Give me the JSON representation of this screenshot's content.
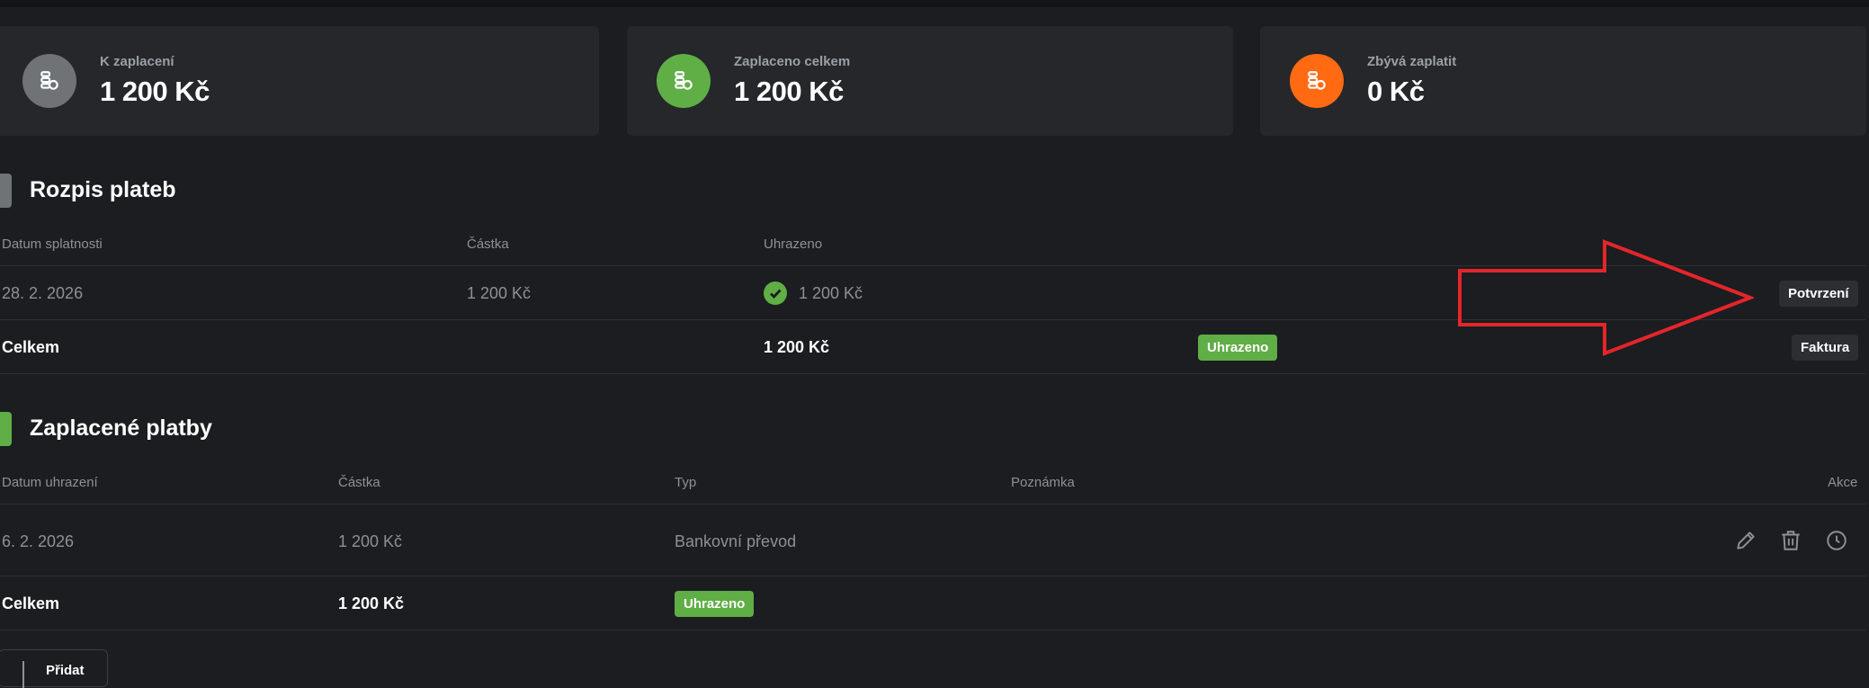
{
  "summary": [
    {
      "label": "K zaplacení",
      "value": "1 200 Kč",
      "color": "#6f7378",
      "icon": "coins-icon"
    },
    {
      "label": "Zaplaceno celkem",
      "value": "1 200 Kč",
      "color": "#5fae46",
      "icon": "coins-icon"
    },
    {
      "label": "Zbývá zaplatit",
      "value": "0 Kč",
      "color": "#ff6a13",
      "icon": "coins-icon"
    }
  ],
  "schedule": {
    "title": "Rozpis plateb",
    "accent": "#6f7378",
    "headers": [
      "Datum splatnosti",
      "Částka",
      "Uhrazeno"
    ],
    "row": {
      "due_date": "28. 2. 2026",
      "amount": "1 200 Kč",
      "paid": "1 200 Kč",
      "action": "Potvrzení"
    },
    "total": {
      "label": "Celkem",
      "paid": "1 200 Kč",
      "status": "Uhrazeno",
      "action": "Faktura"
    }
  },
  "payments": {
    "title": "Zaplacené platby",
    "accent": "#5fae46",
    "headers": [
      "Datum uhrazení",
      "Částka",
      "Typ",
      "Poznámka",
      "Akce"
    ],
    "row": {
      "date": "6. 2. 2026",
      "amount": "1 200 Kč",
      "type": "Bankovní převod",
      "note": ""
    },
    "total": {
      "label": "Celkem",
      "amount": "1 200 Kč",
      "status": "Uhrazeno"
    },
    "add_label": "Přidat"
  },
  "annotation": {
    "type": "arrow",
    "color": "#e5252a"
  }
}
